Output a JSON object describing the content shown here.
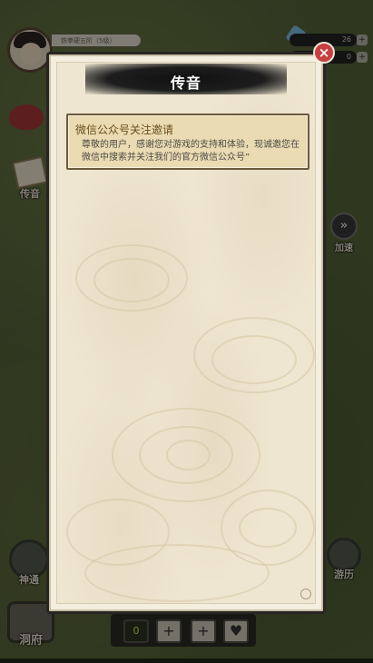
{
  "hud": {
    "player_name": "铁拳硬五阶（5级）",
    "resource1": "26",
    "resource2": "0",
    "add_symbol": "+"
  },
  "left_menu": [
    {
      "label": "传音"
    },
    {
      "label": "神通"
    },
    {
      "label": "洞府"
    }
  ],
  "right_menu": [
    {
      "label": "加速",
      "glyph": "»"
    },
    {
      "label": "游历"
    }
  ],
  "bottom_slots": [
    "0",
    "+",
    "+",
    "♥"
  ],
  "modal": {
    "title": "传音",
    "close_glyph": "×",
    "mails": [
      {
        "title": "微信公众号关注邀请",
        "body": "尊敬的用户，感谢您对游戏的支持和体验，现诚邀您在微信中搜索并关注我们的官方微信公众号”"
      }
    ]
  },
  "colors": {
    "close_button": "#c83f3f",
    "parchment": "#efe6d1",
    "mail_card": "#eadbb2"
  }
}
